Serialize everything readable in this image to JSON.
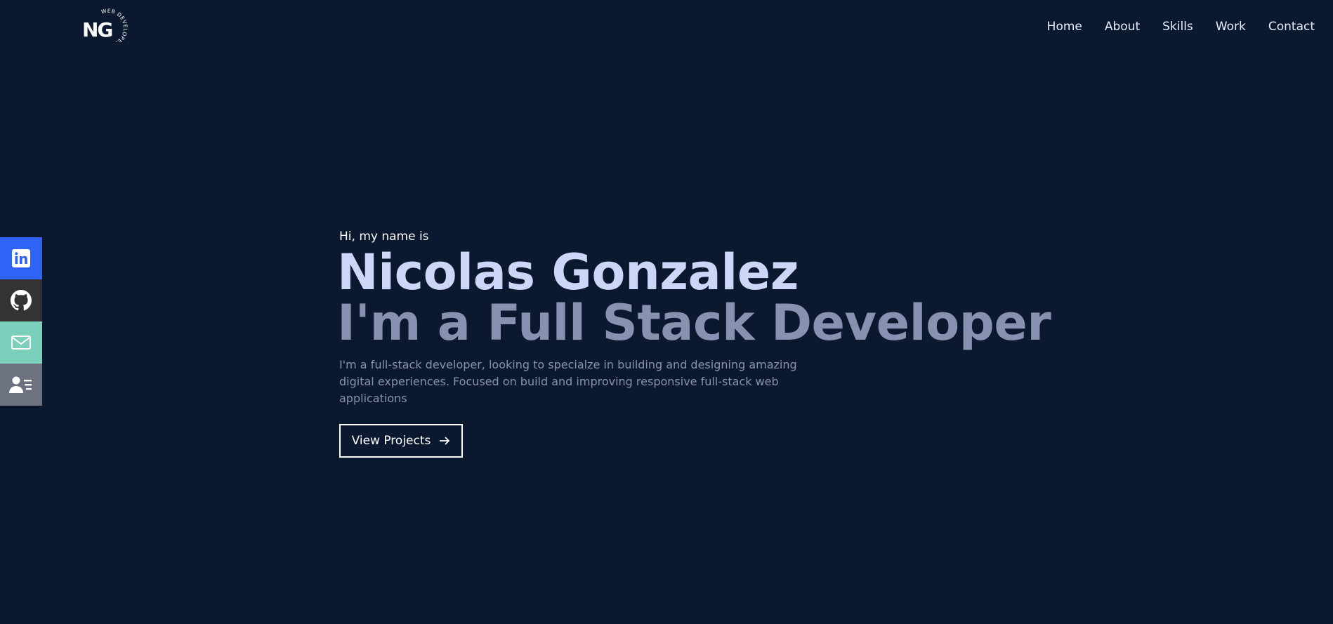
{
  "header": {
    "logo": {
      "monogram": "NG",
      "ring_text": "WEB DEVELOPER"
    },
    "nav": [
      {
        "label": "Home"
      },
      {
        "label": "About"
      },
      {
        "label": "Skills"
      },
      {
        "label": "Work"
      },
      {
        "label": "Contact"
      }
    ]
  },
  "social": [
    {
      "name": "linkedin",
      "icon": "linkedin-icon",
      "color": "#2f62f5"
    },
    {
      "name": "github",
      "icon": "github-icon",
      "color": "#333333"
    },
    {
      "name": "email",
      "icon": "mail-icon",
      "color": "#7ccfbb"
    },
    {
      "name": "resume",
      "icon": "contact-card-icon",
      "color": "#6c7280"
    }
  ],
  "hero": {
    "intro": "Hi, my name is",
    "name": "Nicolas Gonzalez",
    "role": "I'm a Full Stack Developer",
    "description": "I'm a full-stack developer, looking to specialze in building and designing amazing digital experiences. Focused on build and improving responsive full-stack web applications",
    "cta_label": "View Projects"
  },
  "colors": {
    "background": "#0a192f",
    "heading": "#ccd6f6",
    "subheading": "#8892b0",
    "text": "#ffffff"
  }
}
